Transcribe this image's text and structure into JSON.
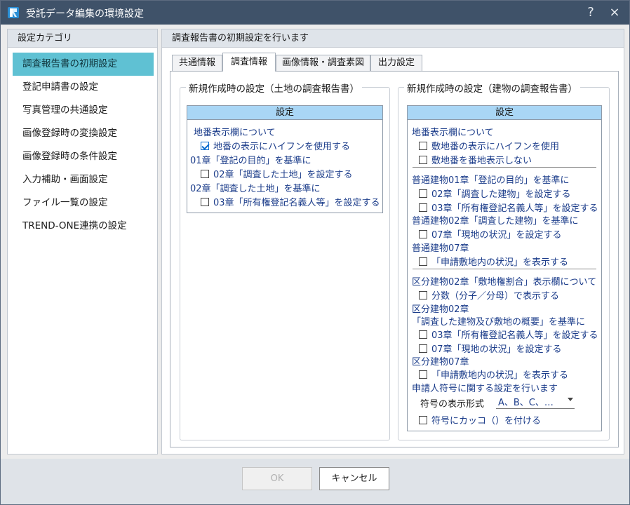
{
  "window": {
    "title": "受託データ編集の環境設定",
    "help": "?",
    "close": "×"
  },
  "left": {
    "header": "設定カテゴリ",
    "items": [
      {
        "label": "調査報告書の初期設定"
      },
      {
        "label": "登記申請書の設定"
      },
      {
        "label": "写真管理の共通設定"
      },
      {
        "label": "画像登録時の変換設定"
      },
      {
        "label": "画像登録時の条件設定"
      },
      {
        "label": "入力補助・画面設定"
      },
      {
        "label": "ファイル一覧の設定"
      },
      {
        "label": "TREND-ONE連携の設定"
      }
    ]
  },
  "right": {
    "header": "調査報告書の初期設定を行います",
    "tabs": [
      "共通情報",
      "調査情報",
      "画像情報・調査素図",
      "出力設定"
    ]
  },
  "land": {
    "legend": "新規作成時の設定（土地の調査報告書）",
    "box_header": "設定",
    "h1": "地番表示欄について",
    "c1": "地番の表示にハイフンを使用する",
    "h2": "01章「登記の目的」を基準に",
    "c2": "02章「調査した土地」を設定する",
    "h3": "02章「調査した土地」を基準に",
    "c3": "03章「所有権登記名義人等」を設定する"
  },
  "building": {
    "legend": "新規作成時の設定（建物の調査報告書）",
    "box_header": "設定",
    "h1": "地番表示欄について",
    "c1": "敷地番の表示にハイフンを使用",
    "c2": "敷地番を番地表示しない",
    "h2": "普通建物01章「登記の目的」を基準に",
    "c3": "02章「調査した建物」を設定する",
    "c4": "03章「所有権登記名義人等」を設定する",
    "h3": "普通建物02章「調査した建物」を基準に",
    "c5": "07章「現地の状況」を設定する",
    "h4": "普通建物07章",
    "c6": "「申請敷地内の状況」を表示する",
    "h5": "区分建物02章「敷地権割合」表示欄について",
    "c7": "分数（分子／分母）で表示する",
    "h6": "区分建物02章",
    "h7": "「調査した建物及び敷地の概要」を基準に",
    "c8": "03章「所有権登記名義人等」を設定する",
    "c9": "07章「現地の状況」を設定する",
    "h8": "区分建物07章",
    "c10": "「申請敷地内の状況」を表示する",
    "h9": "申請人符号に関する設定を行います",
    "symbol_label": "符号の表示形式",
    "symbol_value": "A、B、C、…",
    "c11": "符号にカッコ（）を付ける"
  },
  "footer": {
    "ok": "OK",
    "cancel": "キャンセル"
  },
  "colors": {
    "titlebar": "#3f5269",
    "selected_category": "#5fc1d3",
    "setting_header": "#a9d6f5",
    "option_text": "#1b3c8a"
  }
}
